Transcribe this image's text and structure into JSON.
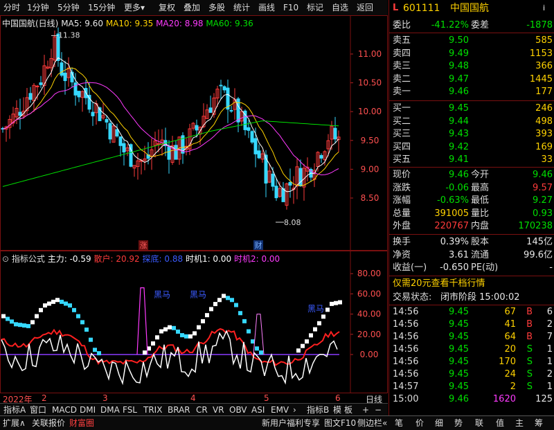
{
  "toolbar": {
    "items": [
      "分时",
      "1分钟",
      "5分钟",
      "15分钟",
      "更多",
      "复权",
      "叠加",
      "多股",
      "统计",
      "画线",
      "F10",
      "标记",
      "自选",
      "返回"
    ]
  },
  "main_chart": {
    "title": "中国国航(日线)",
    "legend": [
      {
        "label": "MA5: 9.60",
        "color": "#ffffff"
      },
      {
        "label": "MA10: 9.35",
        "color": "#ffd200"
      },
      {
        "label": "MA20: 8.98",
        "color": "#ff3bff"
      },
      {
        "label": "MA60: 9.36",
        "color": "#00e000"
      }
    ],
    "price_ticks": [
      "11.00",
      "10.50",
      "10.00",
      "9.50",
      "9.00",
      "8.50"
    ],
    "high_mark": "11.38",
    "low_mark": "8.08",
    "tag_zhang": "涨",
    "tag_cai": "财"
  },
  "sub_chart": {
    "legend": [
      {
        "label": "指标公式",
        "color": "#dddddd"
      },
      {
        "label": "主力: -0.59",
        "color": "#ffffff"
      },
      {
        "label": "散户: 20.92",
        "color": "#ff3b3b"
      },
      {
        "label": "探底: 0.88",
        "color": "#3b5bff"
      },
      {
        "label": "时机1: 0.00",
        "color": "#ffffff"
      },
      {
        "label": "时机2: 0.00",
        "color": "#ff3bff"
      }
    ],
    "ticks": [
      "80.00",
      "60.00",
      "40.00",
      "20.00",
      "0.00"
    ],
    "labels": [
      "黑马",
      "黑马",
      "黑马"
    ]
  },
  "date_axis": {
    "labels": [
      "2022年",
      "2",
      "3",
      "4",
      "5",
      "6"
    ],
    "unit": "日线"
  },
  "indicator_tabs": [
    "指标A",
    "窗口",
    "MACD",
    "DMI",
    "DMA",
    "FSL",
    "TRIX",
    "BRAR",
    "CR",
    "VR",
    "OBV",
    "ASI",
    "EMV",
    "指标B",
    "模",
    "板"
  ],
  "bottom_bar": {
    "left": [
      "扩展",
      "关联报价",
      "财富圈"
    ],
    "promo": "新用户福利专享",
    "right": [
      "图文F10",
      "侧边栏"
    ],
    "side_tabs": [
      "笔",
      "价",
      "细",
      "势",
      "联",
      "值",
      "主",
      "筹"
    ]
  },
  "quote": {
    "code": "601111",
    "name": "中国国航",
    "weibi_label": "委比",
    "weibi": "-41.22%",
    "weicha_label": "委差",
    "weicha": "-1878",
    "asks": [
      {
        "label": "卖五",
        "price": "9.50",
        "vol": "585"
      },
      {
        "label": "卖四",
        "price": "9.49",
        "vol": "1153"
      },
      {
        "label": "卖三",
        "price": "9.48",
        "vol": "366"
      },
      {
        "label": "卖二",
        "price": "9.47",
        "vol": "1445"
      },
      {
        "label": "卖一",
        "price": "9.46",
        "vol": "177"
      }
    ],
    "bids": [
      {
        "label": "买一",
        "price": "9.45",
        "vol": "246"
      },
      {
        "label": "买二",
        "price": "9.44",
        "vol": "498"
      },
      {
        "label": "买三",
        "price": "9.43",
        "vol": "393"
      },
      {
        "label": "买四",
        "price": "9.42",
        "vol": "169"
      },
      {
        "label": "买五",
        "price": "9.41",
        "vol": "33"
      }
    ],
    "stats": [
      {
        "l1": "现价",
        "v1": "9.46",
        "c1": "green",
        "l2": "今开",
        "v2": "9.46",
        "c2": "green"
      },
      {
        "l1": "涨跌",
        "v1": "-0.06",
        "c1": "green",
        "l2": "最高",
        "v2": "9.57",
        "c2": "red"
      },
      {
        "l1": "涨幅",
        "v1": "-0.63%",
        "c1": "green",
        "l2": "最低",
        "v2": "9.27",
        "c2": "green"
      },
      {
        "l1": "总量",
        "v1": "391005",
        "c1": "yellow",
        "l2": "量比",
        "v2": "0.93",
        "c2": "green"
      },
      {
        "l1": "外盘",
        "v1": "220767",
        "c1": "red",
        "l2": "内盘",
        "v2": "170238",
        "c2": "green"
      }
    ],
    "stats2": [
      {
        "l1": "换手",
        "v1": "0.39%",
        "l2": "股本",
        "v2": "145亿"
      },
      {
        "l1": "净资",
        "v1": "3.61",
        "l2": "流通",
        "v2": "99.6亿"
      },
      {
        "l1": "收益(一)",
        "v1": "-0.650",
        "l2": "PE(动)",
        "v2": "-"
      }
    ],
    "promo": "仅需20元查看千档行情",
    "status_label": "交易状态:",
    "status": "闭市阶段 15:00:02",
    "ticks": [
      {
        "t": "14:56",
        "p": "9.45",
        "v": "67",
        "bs": "B",
        "n": "6"
      },
      {
        "t": "14:56",
        "p": "9.45",
        "v": "41",
        "bs": "B",
        "n": "2"
      },
      {
        "t": "14:56",
        "p": "9.45",
        "v": "64",
        "bs": "B",
        "n": "7"
      },
      {
        "t": "14:56",
        "p": "9.45",
        "v": "20",
        "bs": "S",
        "n": "1"
      },
      {
        "t": "14:56",
        "p": "9.45",
        "v": "170",
        "bs": "S",
        "n": "1"
      },
      {
        "t": "14:56",
        "p": "9.45",
        "v": "24",
        "bs": "S",
        "n": "2"
      },
      {
        "t": "14:57",
        "p": "9.45",
        "v": "2",
        "bs": "S",
        "n": "1"
      },
      {
        "t": "15:00",
        "p": "9.46",
        "v": "1620",
        "bs": "",
        "n": "125"
      }
    ]
  }
}
